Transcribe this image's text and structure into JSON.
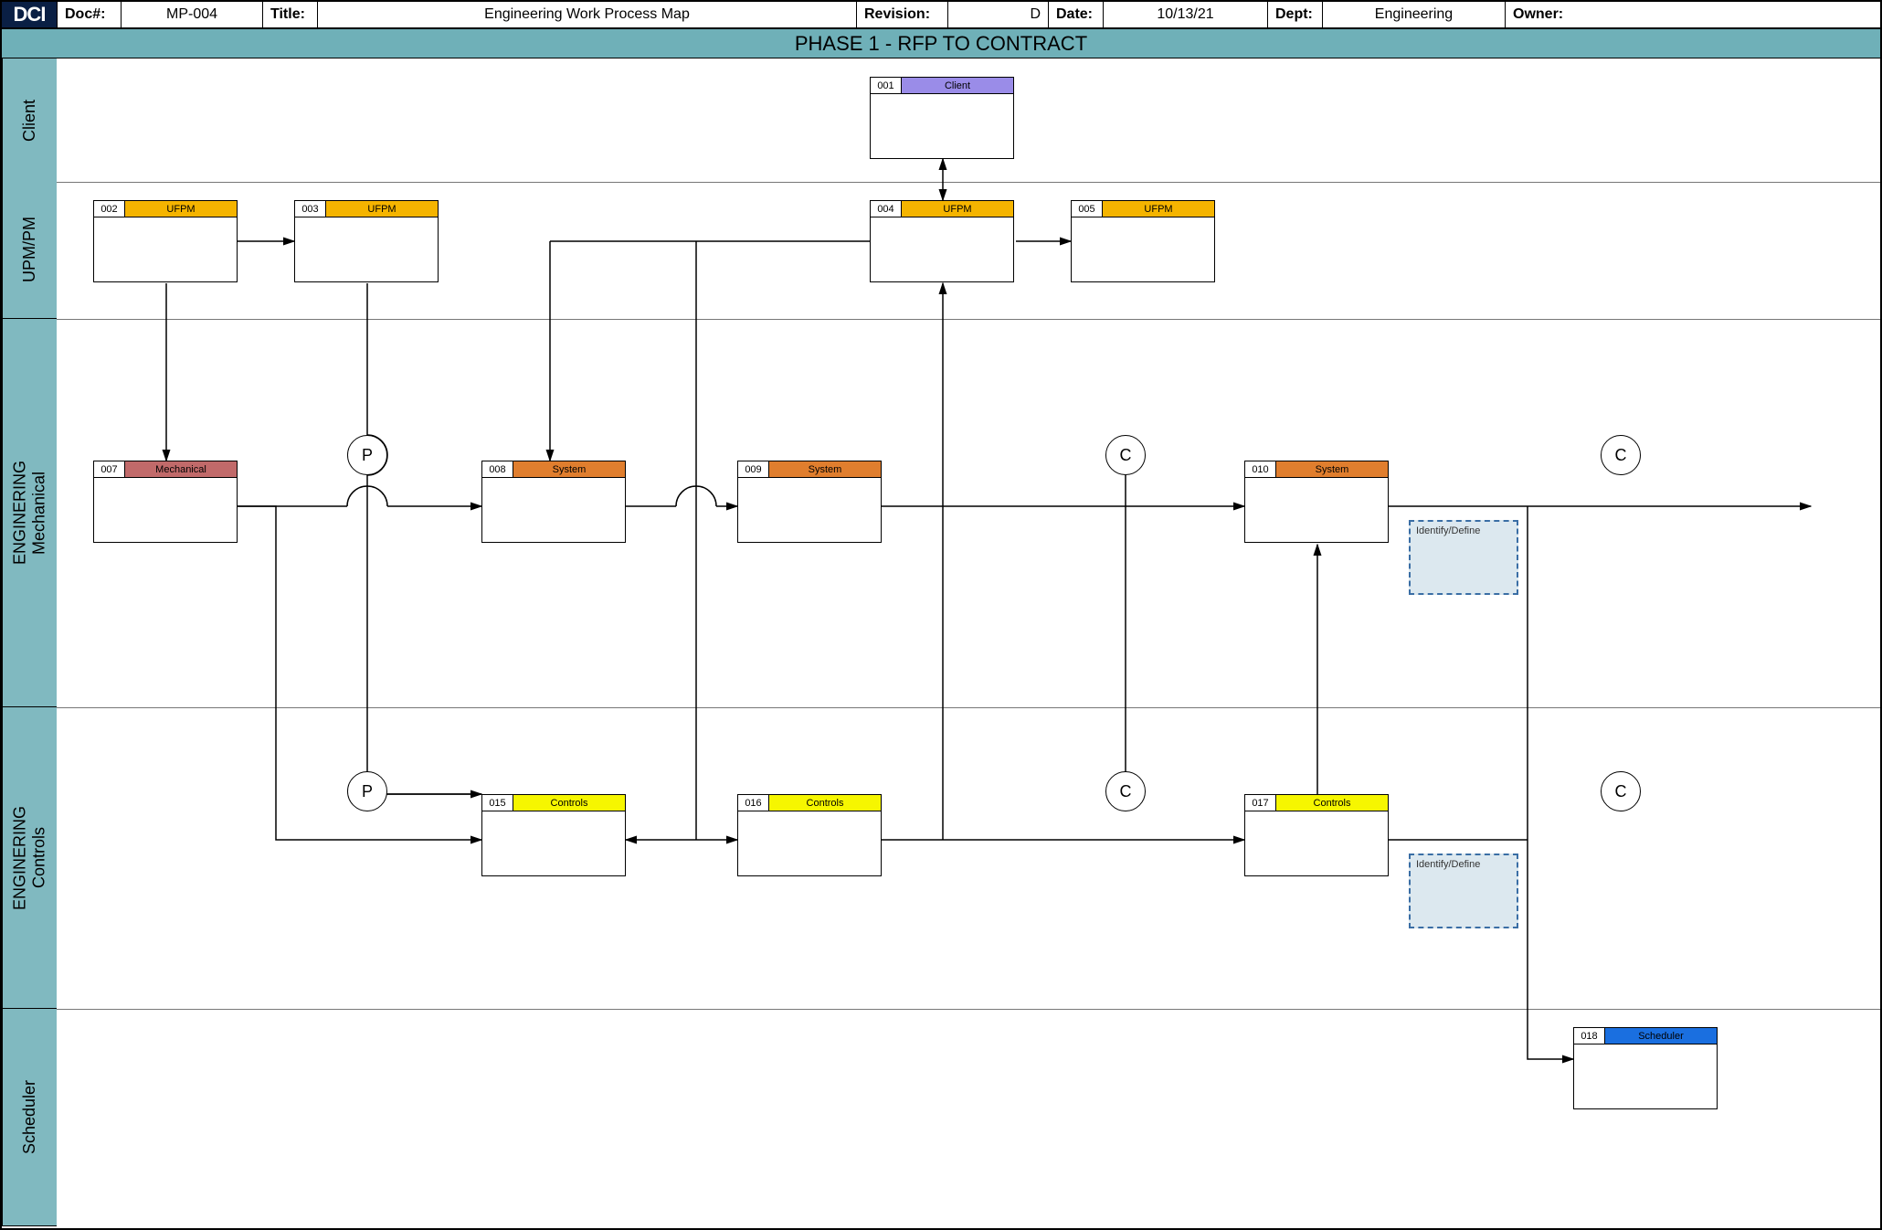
{
  "header": {
    "logo": "DCI",
    "docnum_label": "Doc#:",
    "docnum": "MP-004",
    "title_label": "Title:",
    "title": "Engineering Work Process Map",
    "rev_label": "Revision:",
    "rev": "D",
    "date_label": "Date:",
    "date": "10/13/21",
    "dept_label": "Dept:",
    "dept": "Engineering",
    "owner_label": "Owner:"
  },
  "phase": "PHASE 1 - RFP TO CONTRACT",
  "lanes": {
    "client": "Client",
    "upm": "UPM/PM",
    "mech": "ENGINERING\nMechanical",
    "controls": "ENGINERING\nControls",
    "sched": "Scheduler"
  },
  "boxes": {
    "b001": {
      "num": "001",
      "role": "Client"
    },
    "b002": {
      "num": "002",
      "role": "UFPM"
    },
    "b003": {
      "num": "003",
      "role": "UFPM"
    },
    "b004": {
      "num": "004",
      "role": "UFPM"
    },
    "b005": {
      "num": "005",
      "role": "UFPM"
    },
    "b007": {
      "num": "007",
      "role": "Mechanical"
    },
    "b008": {
      "num": "008",
      "role": "System"
    },
    "b009": {
      "num": "009",
      "role": "System"
    },
    "b010": {
      "num": "010",
      "role": "System"
    },
    "b015": {
      "num": "015",
      "role": "Controls"
    },
    "b016": {
      "num": "016",
      "role": "Controls"
    },
    "b017": {
      "num": "017",
      "role": "Controls"
    },
    "b018": {
      "num": "018",
      "role": "Scheduler"
    }
  },
  "notes": {
    "n1": "Identify/Define",
    "n2": "Identify/Define"
  },
  "connectors": {
    "p": "P",
    "c": "C"
  }
}
